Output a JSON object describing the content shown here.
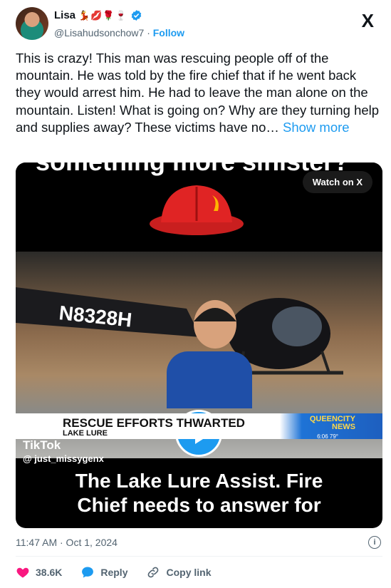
{
  "author": {
    "name": "Lisa",
    "emojis": "💃💋🌹🍷",
    "handle": "@Lisahudsonchow7",
    "follow_label": "Follow"
  },
  "brand": {
    "logo": "X"
  },
  "tweet": {
    "text": "This is crazy! This man was rescuing people off of the mountain. He was told by the fire chief that if he went back they would arrest him.  He had to leave the man alone on the mountain. Listen! What is going on? Why are they turning help and supplies away? These victims have no…",
    "show_more": "Show more",
    "timestamp": "11:47 AM · Oct 1, 2024"
  },
  "media": {
    "watch_label": "Watch on X",
    "top_text": "something more sinister?",
    "tail_number": "N8328H",
    "tiktok_word": "TikTok",
    "tiktok_user": "@ just_missygenx",
    "banner_title": "RESCUE EFFORTS THWARTED",
    "banner_subtitle": "LAKE LURE",
    "station_line1": "QUEENCITY",
    "station_line2": "NEWS",
    "station_time": "6:06   79°",
    "caption_line1": "The Lake Lure Assist. Fire",
    "caption_line2": "Chief needs to answer for"
  },
  "actions": {
    "likes": "38.6K",
    "reply_label": "Reply",
    "copy_label": "Copy link"
  },
  "colors": {
    "accent": "#1d9bf0",
    "like": "#f91880",
    "text": "#0f1419",
    "muted": "#536471"
  }
}
